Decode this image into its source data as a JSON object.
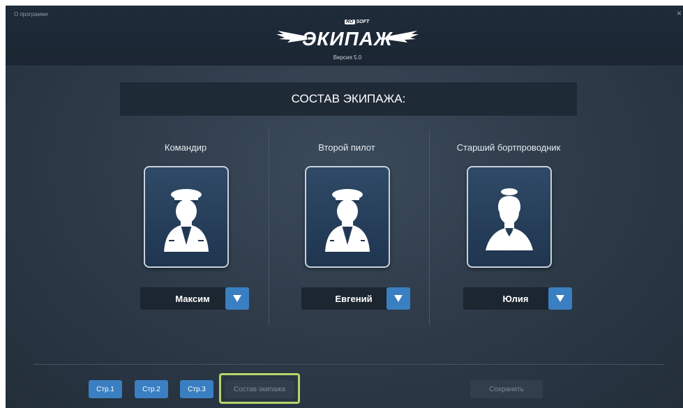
{
  "window": {
    "about_label": "О программе",
    "close_label": "×"
  },
  "logo": {
    "brand_badge": "RO",
    "brand_text": "SOFT",
    "wordmark": "ЭКИПАЖ",
    "version": "Версия 5.0"
  },
  "section_title": "СОСТАВ ЭКИПАЖА:",
  "crew": [
    {
      "role": "Командир",
      "selected": "Максим",
      "avatar_icon": "captain-avatar-icon"
    },
    {
      "role": "Второй пилот",
      "selected": "Евгений",
      "avatar_icon": "pilot-avatar-icon"
    },
    {
      "role": "Старший бортпроводник",
      "selected": "Юлия",
      "avatar_icon": "flight-attendant-avatar-icon"
    }
  ],
  "footer": {
    "page1": "Стр.1",
    "page2": "Стр.2",
    "page3": "Стр.3",
    "crew_tab": "Состав экипажа",
    "save": "Сохранить"
  },
  "colors": {
    "accent": "#3a7fc1",
    "highlight": "#b6d66a"
  }
}
